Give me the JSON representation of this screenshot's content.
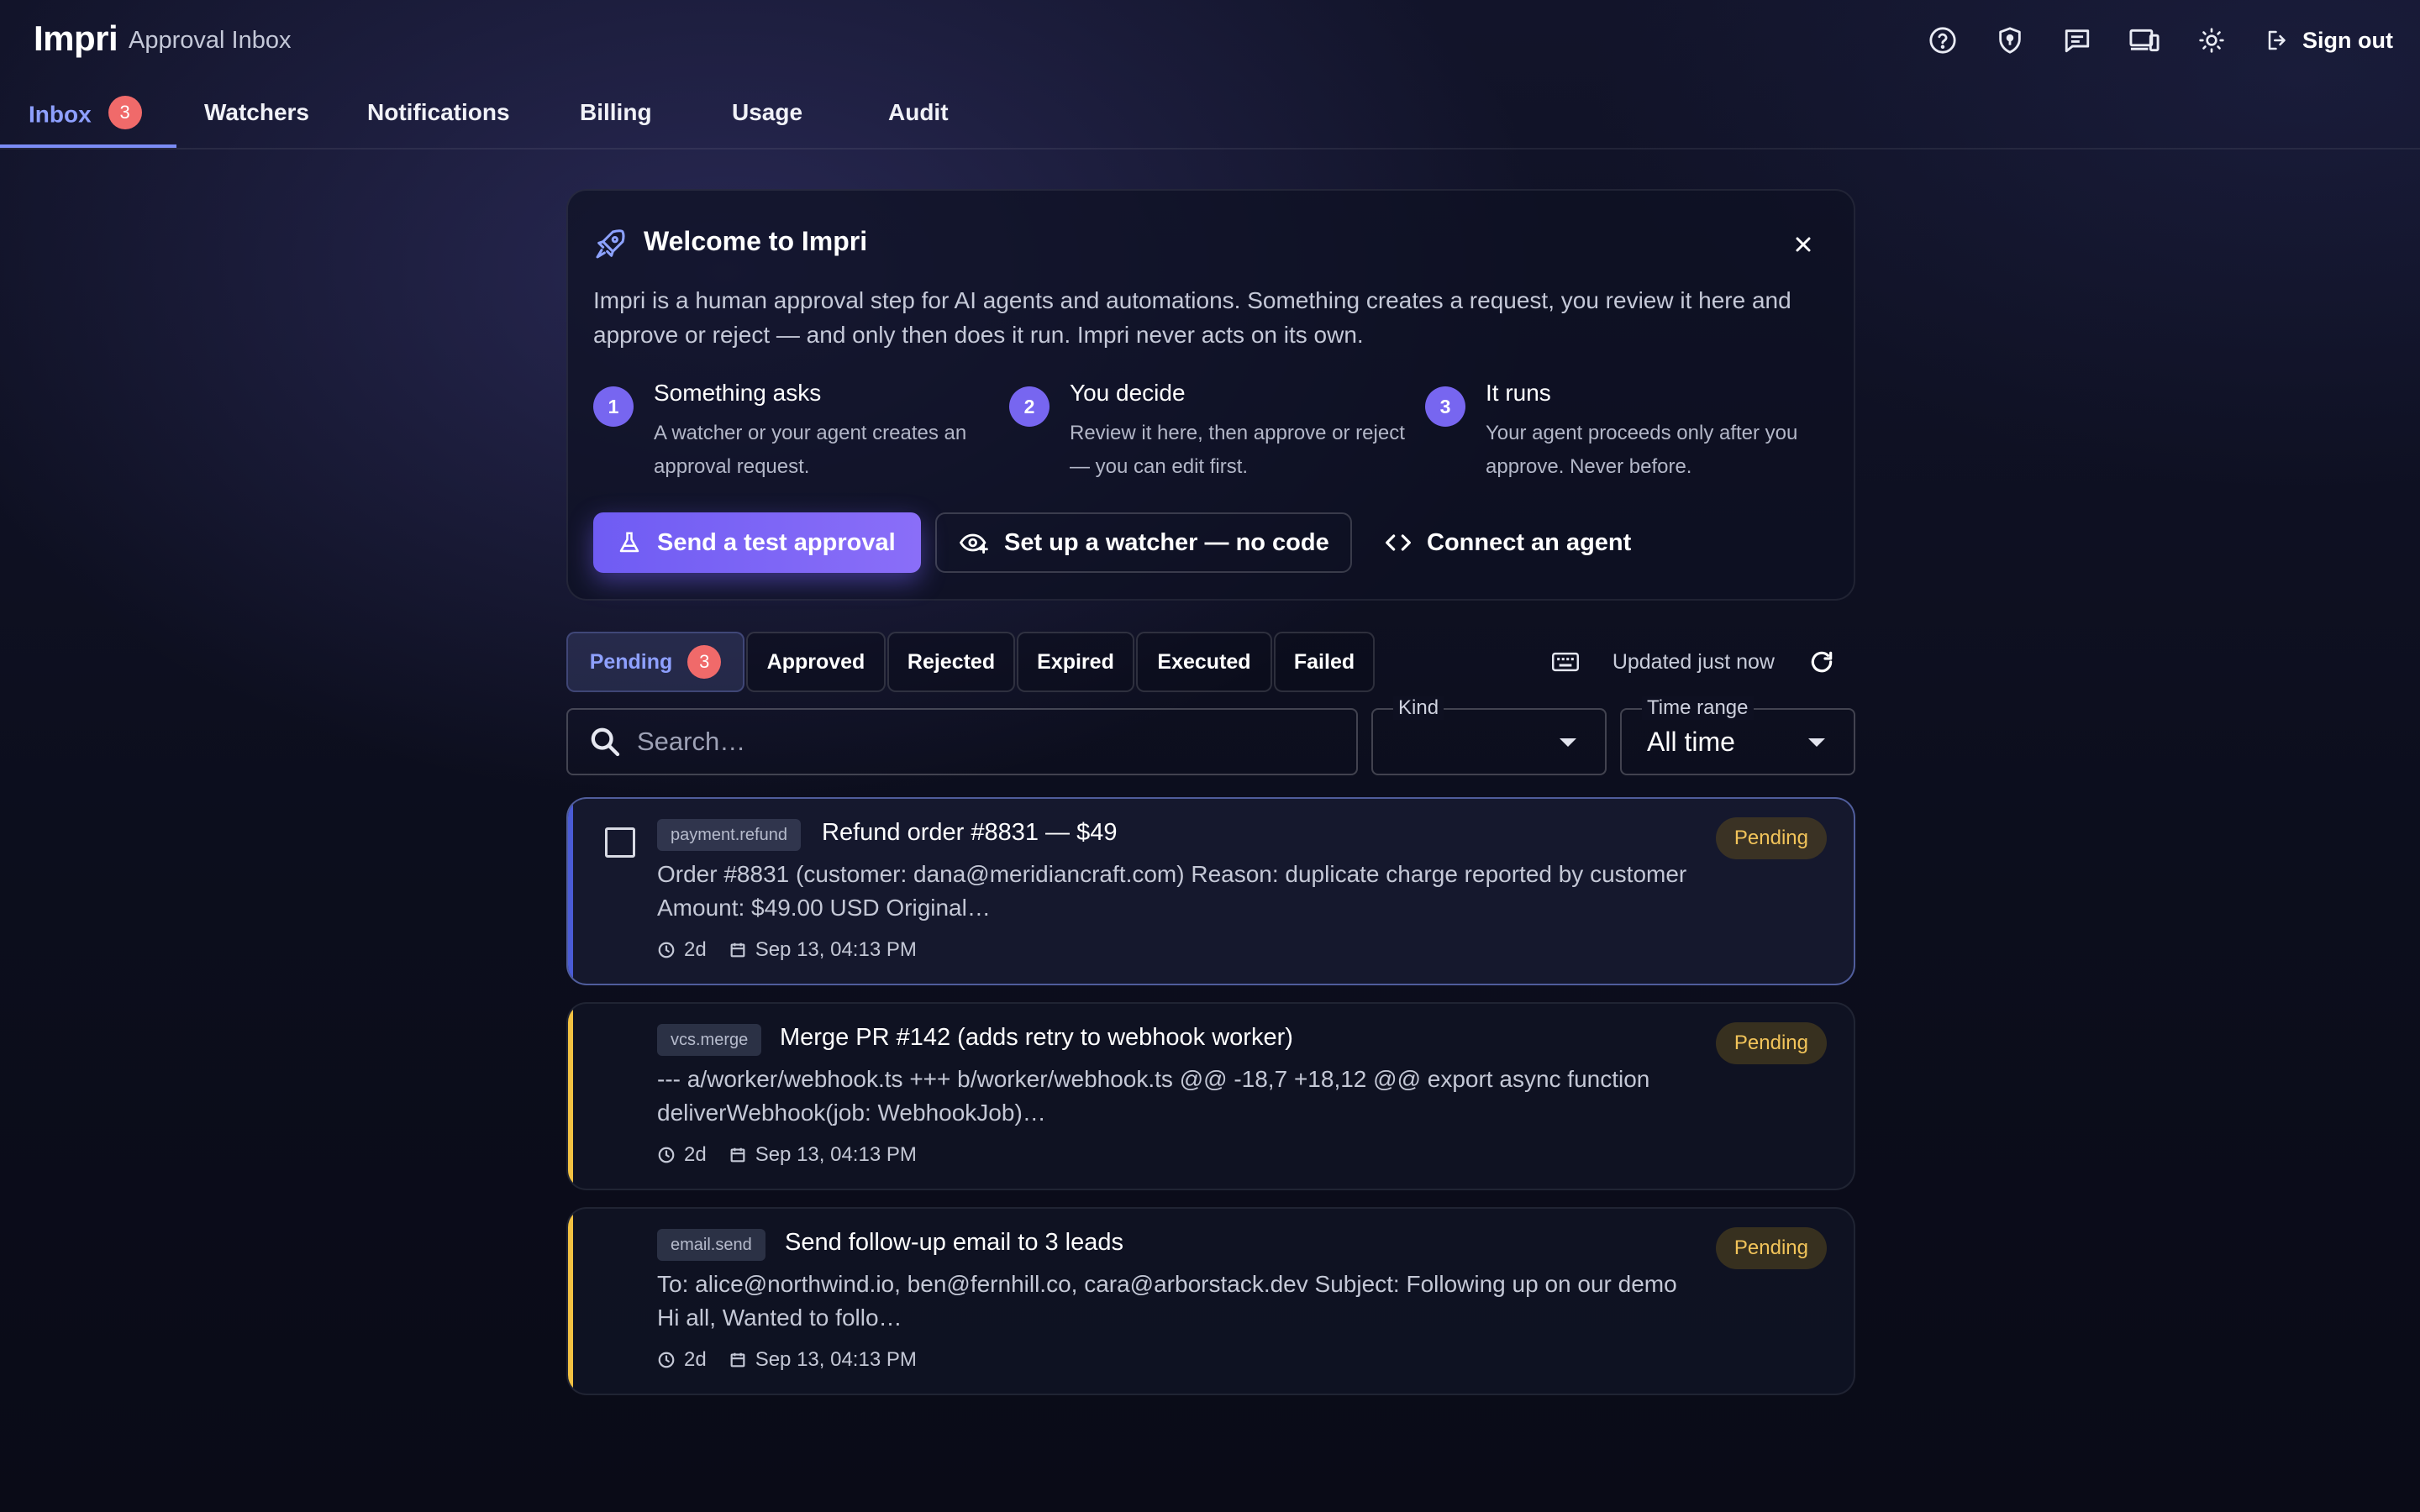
{
  "app": {
    "brand": "Impri",
    "subtitle": "Approval Inbox"
  },
  "header": {
    "icons": [
      "help-icon",
      "shield-icon",
      "chat-icon",
      "devices-icon",
      "theme-icon"
    ],
    "signout_label": "Sign out"
  },
  "nav": {
    "tabs": [
      {
        "label": "Inbox",
        "badge": "3",
        "active": true
      },
      {
        "label": "Watchers"
      },
      {
        "label": "Notifications"
      },
      {
        "label": "Billing"
      },
      {
        "label": "Usage"
      },
      {
        "label": "Audit"
      }
    ]
  },
  "welcome": {
    "title": "Welcome to Impri",
    "intro": "Impri is a human approval step for AI agents and automations. Something creates a request, you review it here and approve or reject — and only then does it run. Impri never acts on its own.",
    "steps": [
      {
        "num": "1",
        "title": "Something asks",
        "desc": "A watcher or your agent creates an approval request."
      },
      {
        "num": "2",
        "title": "You decide",
        "desc": "Review it here, then approve or reject — you can edit first."
      },
      {
        "num": "3",
        "title": "It runs",
        "desc": "Your agent proceeds only after you approve. Never before."
      }
    ],
    "primary_label": "Send a test approval",
    "watcher_label": "Set up a watcher — no code",
    "agent_label": "Connect an agent"
  },
  "status_tabs": [
    {
      "label": "Pending",
      "badge": "3",
      "active": true
    },
    {
      "label": "Approved"
    },
    {
      "label": "Rejected"
    },
    {
      "label": "Expired"
    },
    {
      "label": "Executed"
    },
    {
      "label": "Failed"
    }
  ],
  "updated_text": "Updated just now",
  "filters": {
    "search_placeholder": "Search…",
    "kind_label": "Kind",
    "kind_value": "",
    "time_label": "Time range",
    "time_value": "All time"
  },
  "requests": [
    {
      "kind": "payment.refund",
      "title": "Refund order #8831 — $49",
      "summary": "Order #8831 (customer: dana@meridiancraft.com) Reason: duplicate charge reported by customer Amount: $49.00 USD Original…",
      "age": "2d",
      "date": "Sep 13, 04:13 PM",
      "status": "Pending",
      "selected": true
    },
    {
      "kind": "vcs.merge",
      "title": "Merge PR #142 (adds retry to webhook worker)",
      "summary": "--- a/worker/webhook.ts +++ b/worker/webhook.ts @@ -18,7 +18,12 @@ export async function deliverWebhook(job: WebhookJob)…",
      "age": "2d",
      "date": "Sep 13, 04:13 PM",
      "status": "Pending"
    },
    {
      "kind": "email.send",
      "title": "Send follow-up email to 3 leads",
      "summary": "To: alice@northwind.io, ben@fernhill.co, cara@arborstack.dev Subject: Following up on our demo Hi all, Wanted to follo…",
      "age": "2d",
      "date": "Sep 13, 04:13 PM",
      "status": "Pending"
    }
  ],
  "colors": {
    "accent": "#7b8cf5",
    "badge": "#f06a6a",
    "pending": "#f2c142",
    "primary": "#7766f0"
  }
}
